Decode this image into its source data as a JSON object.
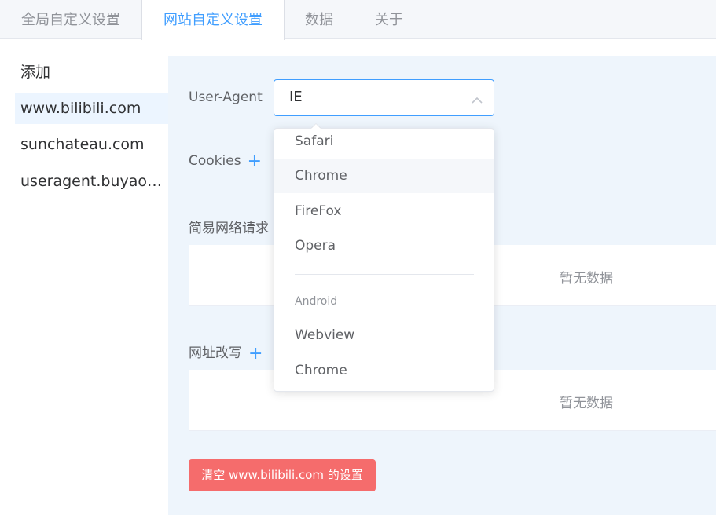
{
  "tabs": [
    {
      "label": "全局自定义设置",
      "active": false
    },
    {
      "label": "网站自定义设置",
      "active": true
    },
    {
      "label": "数据",
      "active": false
    },
    {
      "label": "关于",
      "active": false
    }
  ],
  "sidebar": {
    "items": [
      {
        "label": "添加"
      },
      {
        "label": "www.bilibili.com",
        "active": true
      },
      {
        "label": "sunchateau.com"
      },
      {
        "label": "useragent.buyaocha.com"
      }
    ]
  },
  "form": {
    "user_agent_label": "User-Agent",
    "user_agent_value": "IE",
    "cookies_label": "Cookies",
    "simple_request_label": "简易网络请求",
    "url_rewrite_label": "网址改写",
    "empty_text_1": "暂无数据",
    "empty_text_2": "暂无数据",
    "clear_button": "清空 www.bilibili.com 的设置"
  },
  "dropdown": {
    "options": [
      "Safari",
      "Chrome",
      "FireFox",
      "Opera"
    ],
    "hovered_option": "Chrome",
    "group_title": "Android",
    "group_options": [
      "Webview",
      "Chrome"
    ]
  },
  "colors": {
    "accent": "#409eff",
    "danger": "#f56c6c",
    "panel_bg": "#eef5fc"
  }
}
